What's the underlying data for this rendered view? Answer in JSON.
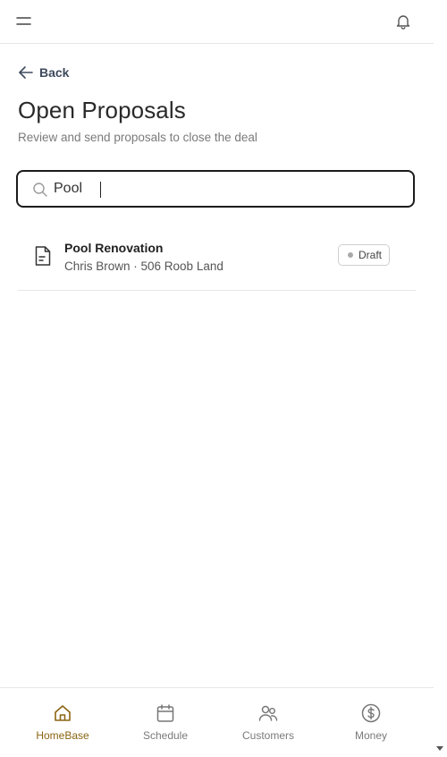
{
  "header": {
    "menu_icon": "hamburger-icon",
    "notifications_icon": "bell-icon"
  },
  "back": {
    "label": "Back",
    "icon": "arrow-left-icon"
  },
  "page": {
    "title": "Open Proposals",
    "subtitle": "Review and send proposals to close the deal"
  },
  "search": {
    "value": "Pool",
    "icon": "search-icon"
  },
  "results": [
    {
      "title": "Pool Renovation",
      "subtitle": "Chris Brown · 506 Roob Land",
      "status": "Draft",
      "icon": "document-icon"
    }
  ],
  "nav": {
    "items": [
      {
        "label": "HomeBase",
        "icon": "home-icon",
        "active": true
      },
      {
        "label": "Schedule",
        "icon": "calendar-icon",
        "active": false
      },
      {
        "label": "Customers",
        "icon": "users-icon",
        "active": false
      },
      {
        "label": "Money",
        "icon": "dollar-icon",
        "active": false
      }
    ]
  },
  "colors": {
    "accent": "#8a6512",
    "badge_dot": "#a9a9a9",
    "border": "#e6e6e6"
  }
}
